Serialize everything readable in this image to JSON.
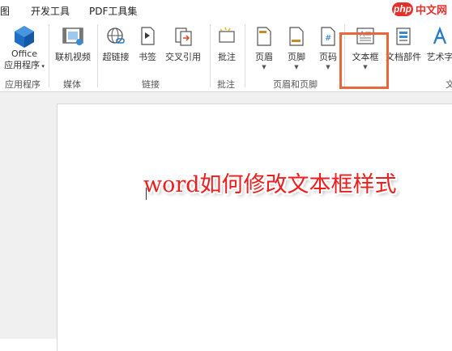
{
  "tabs": {
    "partial": "图",
    "developer": "开发工具",
    "pdf": "PDF工具集"
  },
  "badge": {
    "php": "php",
    "site": "中文网"
  },
  "ribbon": {
    "office_apps_line1": "Office",
    "office_apps_line2": "应用程序",
    "online_video": "联机视频",
    "hyperlink": "超链接",
    "bookmark": "书签",
    "cross_ref": "交叉引用",
    "comment": "批注",
    "header": "页眉",
    "footer": "页脚",
    "page_number": "页码",
    "textbox": "文本框",
    "doc_parts": "文档部件",
    "wordart": "艺术字",
    "groups": {
      "apps": "应用程序",
      "media": "媒体",
      "links": "链接",
      "comments": "批注",
      "header_footer": "页眉和页脚",
      "text_partial": "文"
    }
  },
  "document": {
    "headline": "word如何修改文本框样式"
  },
  "colors": {
    "accent_orange": "#e8683c",
    "headline_red": "#ef1d1d",
    "badge_red": "#e5302a",
    "office_blue": "#1e6fc3"
  }
}
